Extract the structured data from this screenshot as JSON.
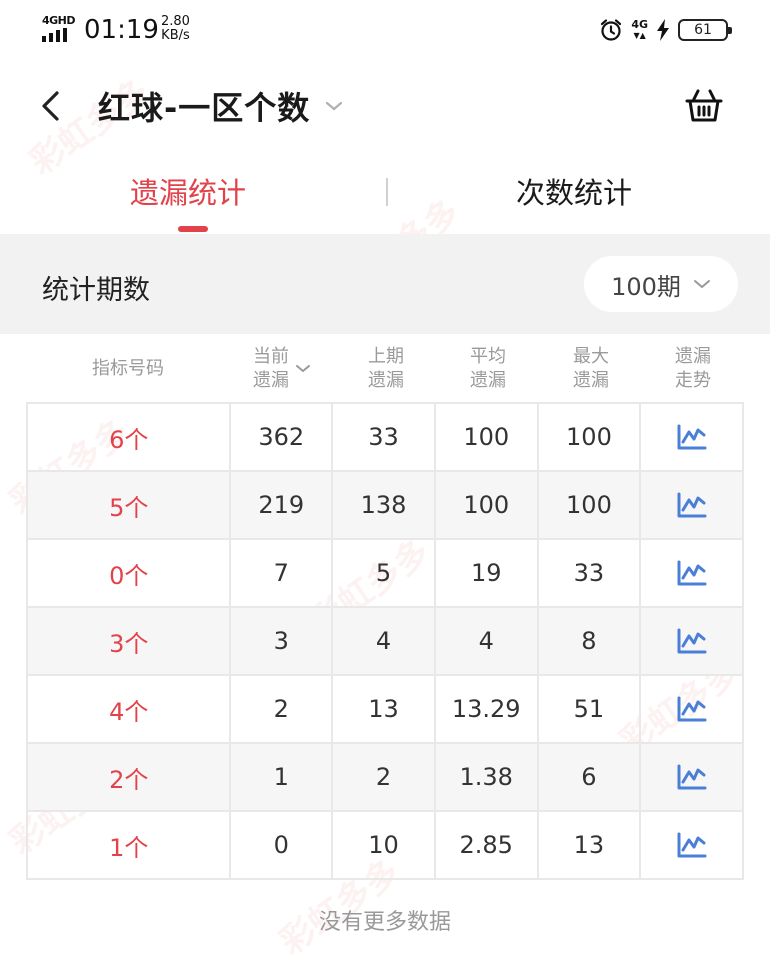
{
  "status_bar": {
    "network": "4GHD",
    "time": "01:19",
    "speed_value": "2.80",
    "speed_unit": "KB/s",
    "network_right": "4G",
    "battery": "61"
  },
  "header": {
    "title": "红球-一区个数"
  },
  "tabs": [
    {
      "label": "遗漏统计",
      "active": true
    },
    {
      "label": "次数统计",
      "active": false
    }
  ],
  "period": {
    "label": "统计期数",
    "value": "100期"
  },
  "table": {
    "headers": [
      {
        "line1": "指标号码",
        "line2": ""
      },
      {
        "line1": "当前",
        "line2": "遗漏"
      },
      {
        "line1": "上期",
        "line2": "遗漏"
      },
      {
        "line1": "平均",
        "line2": "遗漏"
      },
      {
        "line1": "最大",
        "line2": "遗漏"
      },
      {
        "line1": "遗漏",
        "line2": "走势"
      }
    ],
    "rows": [
      {
        "indicator": "6个",
        "current": "362",
        "last": "33",
        "avg": "100",
        "max": "100"
      },
      {
        "indicator": "5个",
        "current": "219",
        "last": "138",
        "avg": "100",
        "max": "100"
      },
      {
        "indicator": "0个",
        "current": "7",
        "last": "5",
        "avg": "19",
        "max": "33"
      },
      {
        "indicator": "3个",
        "current": "3",
        "last": "4",
        "avg": "4",
        "max": "8"
      },
      {
        "indicator": "4个",
        "current": "2",
        "last": "13",
        "avg": "13.29",
        "max": "51"
      },
      {
        "indicator": "2个",
        "current": "1",
        "last": "2",
        "avg": "1.38",
        "max": "6"
      },
      {
        "indicator": "1个",
        "current": "0",
        "last": "10",
        "avg": "2.85",
        "max": "13"
      }
    ]
  },
  "footer": {
    "no_more": "没有更多数据"
  },
  "watermark": "彩虹多多",
  "colors": {
    "accent": "#e2424a",
    "trend_icon": "#4a7fd8"
  }
}
